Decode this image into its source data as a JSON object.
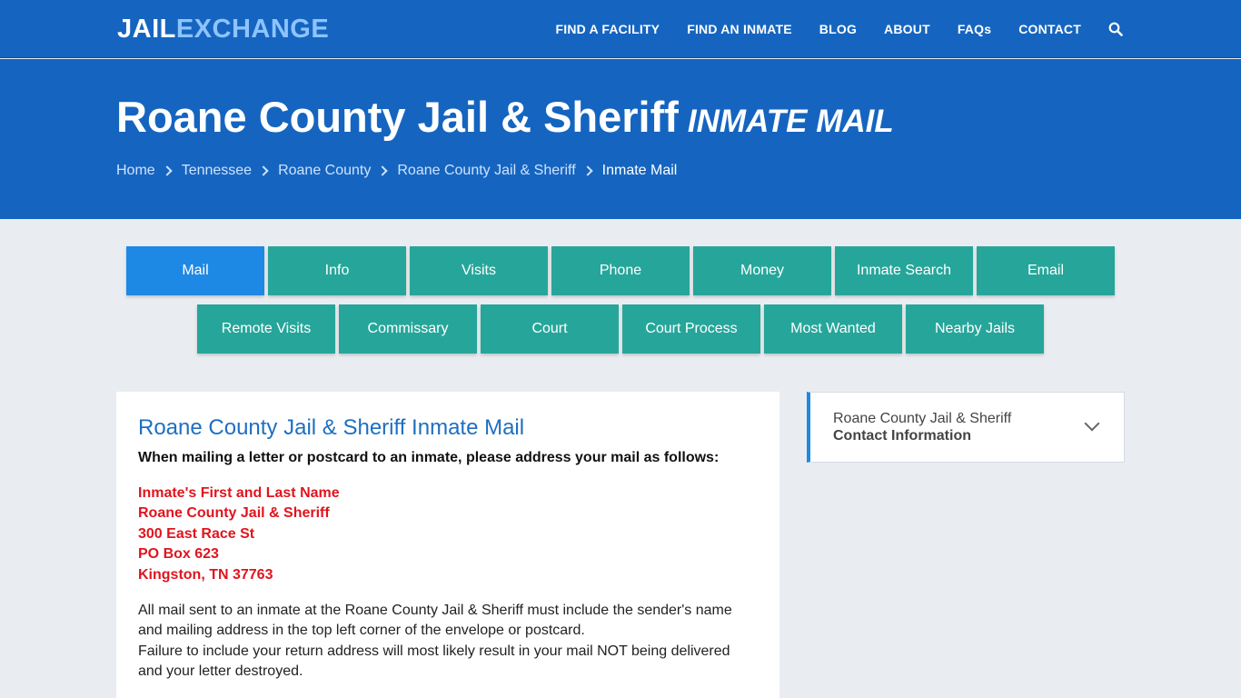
{
  "logo": {
    "part1": "JAIL",
    "part2": "EXCHANGE"
  },
  "nav": {
    "items": [
      "FIND A FACILITY",
      "FIND AN INMATE",
      "BLOG",
      "ABOUT",
      "FAQs",
      "CONTACT"
    ],
    "search_icon": "search-icon"
  },
  "hero": {
    "title": "Roane County Jail & Sheriff",
    "subtitle": "Inmate Mail",
    "breadcrumb": [
      "Home",
      "Tennessee",
      "Roane County",
      "Roane County Jail & Sheriff",
      "Inmate Mail"
    ]
  },
  "tabs": {
    "row1": [
      "Mail",
      "Info",
      "Visits",
      "Phone",
      "Money",
      "Inmate Search",
      "Email"
    ],
    "row2": [
      "Remote Visits",
      "Commissary",
      "Court",
      "Court Process",
      "Most Wanted",
      "Nearby Jails"
    ],
    "active": "Mail"
  },
  "main": {
    "heading": "Roane County Jail & Sheriff Inmate Mail",
    "intro": "When mailing a letter or postcard to an inmate, please address your mail as follows:",
    "address": [
      "Inmate's First and Last Name",
      "Roane County Jail & Sheriff",
      "300 East Race St",
      "PO Box 623",
      "Kingston, TN 37763"
    ],
    "para1": "All mail sent to an inmate at the Roane County Jail & Sheriff must include the sender's name and mailing address in the top left corner of the envelope or postcard.",
    "para2": "Failure to include your return address will most likely result in your mail NOT being delivered and your letter destroyed."
  },
  "sidebar": {
    "line1": "Roane County Jail & Sheriff",
    "line2": "Contact Information"
  },
  "colors": {
    "header_blue": "#1565c0",
    "tab_teal": "#26a69a",
    "tab_active": "#1e88e5",
    "address_red": "#e0141e"
  }
}
